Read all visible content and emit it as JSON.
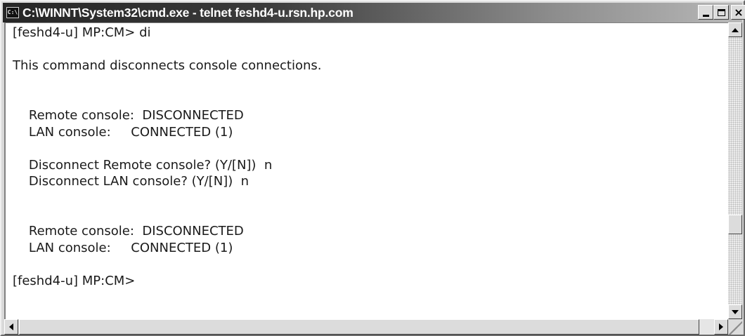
{
  "window": {
    "title": "C:\\WINNT\\System32\\cmd.exe - telnet feshd4-u.rsn.hp.com",
    "app_icon_text": "C:\\",
    "close_glyph": "×"
  },
  "console": {
    "lines": [
      "[feshd4-u] MP:CM> di",
      "",
      "This command disconnects console connections.",
      "",
      "",
      "    Remote console:  DISCONNECTED",
      "    LAN console:     CONNECTED (1)",
      "",
      "    Disconnect Remote console? (Y/[N])  n",
      "    Disconnect LAN console? (Y/[N])  n",
      "",
      "",
      "    Remote console:  DISCONNECTED",
      "    LAN console:     CONNECTED (1)",
      "",
      "[feshd4-u] MP:CM>",
      "",
      ""
    ]
  },
  "colors": {
    "titlebar_dark": "#262626",
    "titlebar_light": "#b8b8b8",
    "console_bg": "#ffffff",
    "console_text": "#1a1a1a",
    "chrome": "#dcdcdc"
  },
  "icons": {
    "app": "console-app-icon",
    "minimize": "minimize-icon",
    "maximize": "maximize-icon",
    "close": "close-icon",
    "scroll_up": "arrow-up-icon",
    "scroll_down": "arrow-down-icon",
    "scroll_left": "arrow-left-icon",
    "scroll_right": "arrow-right-icon"
  }
}
